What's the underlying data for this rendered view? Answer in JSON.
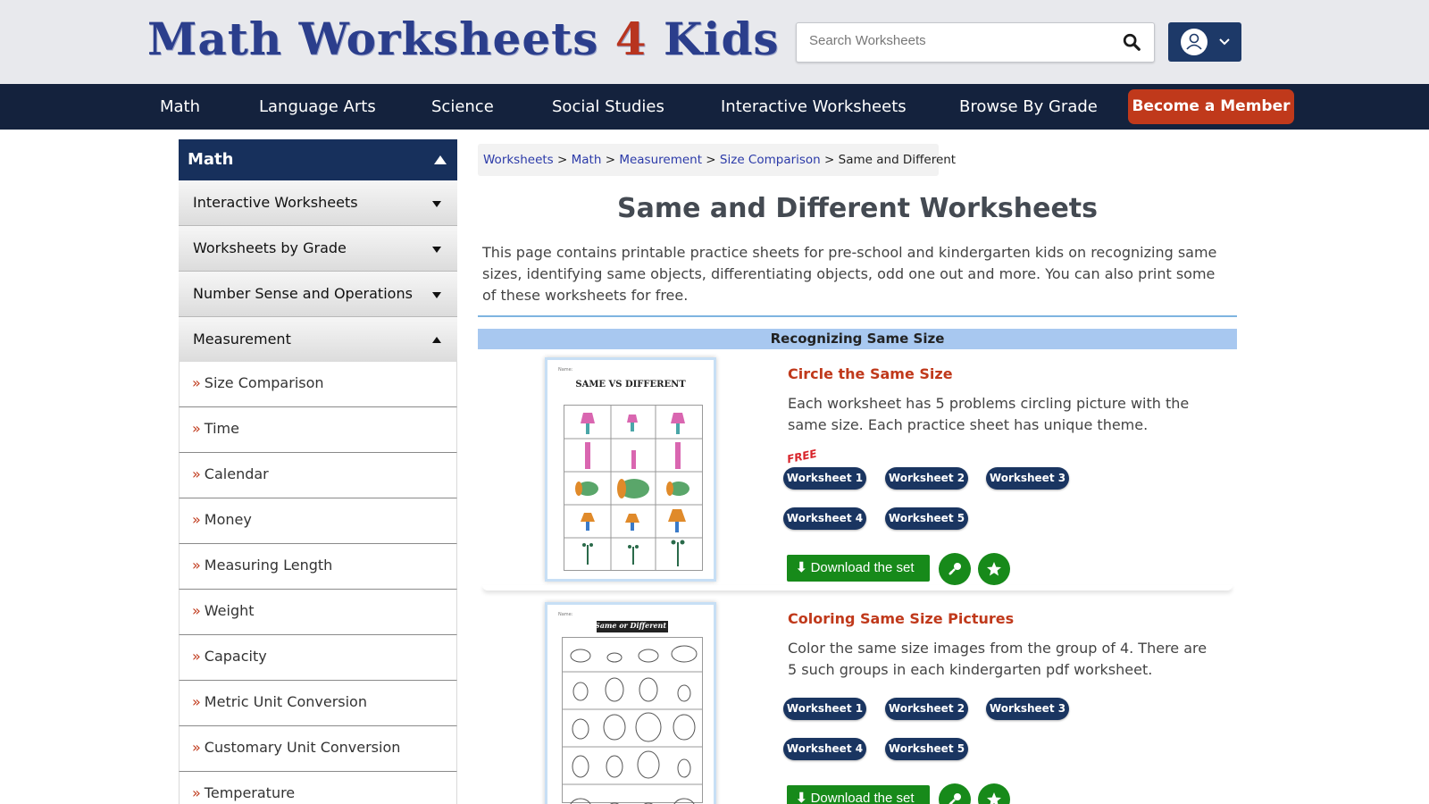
{
  "header": {
    "logo_left": "Math Worksheets ",
    "logo_four": "4",
    "logo_right": " Kids",
    "search_placeholder": "Search Worksheets"
  },
  "nav": {
    "items": [
      "Math",
      "Language Arts",
      "Science",
      "Social Studies",
      "Interactive Worksheets",
      "Browse By Grade"
    ],
    "member": "Become a Member"
  },
  "sidebar": {
    "title": "Math",
    "sections": [
      "Interactive Worksheets",
      "Worksheets by Grade",
      "Number Sense and Operations",
      "Measurement"
    ],
    "links": [
      "Size Comparison",
      "Time",
      "Calendar",
      "Money",
      "Measuring Length",
      "Weight",
      "Capacity",
      "Metric Unit Conversion",
      "Customary Unit Conversion",
      "Temperature"
    ]
  },
  "breadcrumb": {
    "items": [
      "Worksheets",
      "Math",
      "Measurement",
      "Size Comparison"
    ],
    "current": "Same and Different",
    "sep": " > "
  },
  "page": {
    "title": "Same and Different Worksheets",
    "intro": "This page contains printable practice sheets for pre-school and kindergarten kids on recognizing same sizes, identifying same objects, differentiating objects, odd one out and more. You can also print some of these worksheets for free.",
    "section": "Recognizing Same Size"
  },
  "cards": [
    {
      "title": "Circle the Same Size",
      "desc": "Each worksheet has 5 problems circling picture with the same size. Each practice sheet has unique theme.",
      "free": "FREE",
      "thumb_title": "SAME VS DIFFERENT",
      "thumb_name": "Name:",
      "worksheets": [
        "Worksheet 1",
        "Worksheet 2",
        "Worksheet 3",
        "Worksheet 4",
        "Worksheet 5"
      ],
      "download": "Download the set"
    },
    {
      "title": "Coloring Same Size Pictures",
      "desc": "Color the same size images from the group of 4. There are 5 such groups in each kindergarten pdf worksheet.",
      "thumb_title": "Same or Different",
      "thumb_name": "Name:",
      "worksheets": [
        "Worksheet 1",
        "Worksheet 2",
        "Worksheet 3",
        "Worksheet 4",
        "Worksheet 5"
      ],
      "download": "Download the set"
    }
  ],
  "colors": {
    "nav_bg": "#14223d",
    "member": "#c0391b",
    "pill": "#1a3561",
    "download": "#178a1a",
    "title_red": "#c0391b"
  }
}
